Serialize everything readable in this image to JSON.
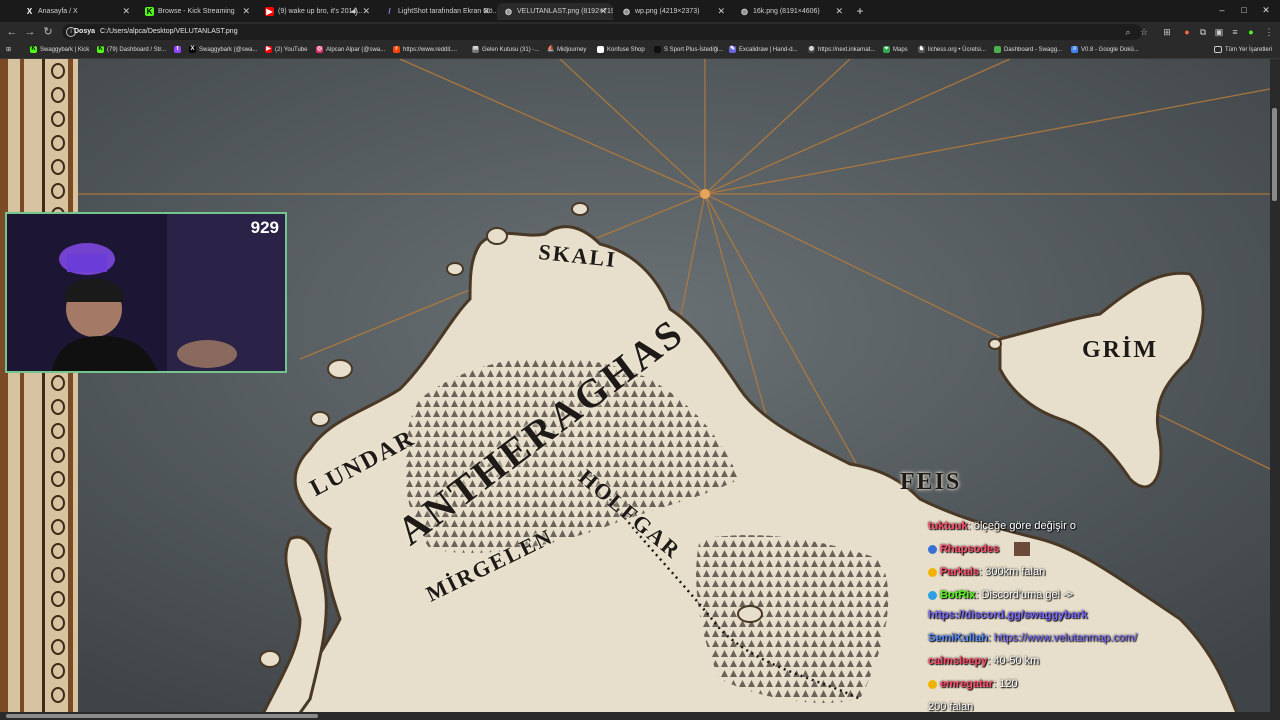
{
  "browser": {
    "tabs": [
      {
        "label": "Anasayfa / X",
        "icon": "x-icon"
      },
      {
        "label": "Browse - Kick Streaming",
        "icon": "kick-icon"
      },
      {
        "label": "(9) wake up bro, it's 2014...",
        "icon": "youtube-icon"
      },
      {
        "label": "LightShot tarafından Ekran Gö...",
        "icon": "lightshot-icon"
      },
      {
        "label": "VELUTANLAST.png (8192×719...",
        "icon": "globe-icon"
      },
      {
        "label": "wp.png (4219×2373)",
        "icon": "globe-icon"
      },
      {
        "label": "16k.png (8191×4606)",
        "icon": "globe-icon"
      }
    ],
    "new_tab": "+",
    "window_controls": {
      "minimize": "–",
      "maximize": "□",
      "close": "✕"
    },
    "address": {
      "scheme": "Dosya",
      "url": "C:/Users/alpca/Desktop/VELUTANLAST.png"
    },
    "bookmarks": [
      {
        "label": "Swaggybark | Kick",
        "color": "#53fc18"
      },
      {
        "label": "(79) Dashboard / Str...",
        "color": "#53fc18"
      },
      {
        "label": "",
        "color": "#9146ff"
      },
      {
        "label": "Swaggybark (@swa...",
        "color": "#000000"
      },
      {
        "label": "(2) YouTube",
        "color": "#ff0000"
      },
      {
        "label": "Alpcan Alpar (@swa...",
        "color": "#e1306c"
      },
      {
        "label": "https://www.reddit....",
        "color": "#ff4500"
      },
      {
        "label": "Gelen Kutusu (31) -...",
        "color": "#777777"
      },
      {
        "label": "Midjourney",
        "color": "#333333"
      },
      {
        "label": "Konfuse Shop",
        "color": "#ffffff"
      },
      {
        "label": "S Sport Plus-İstediği...",
        "color": "#111111"
      },
      {
        "label": "Excalidraw | Hand-d...",
        "color": "#6965db"
      },
      {
        "label": "https://next.inkarnat...",
        "color": "#444444"
      },
      {
        "label": "Maps",
        "color": "#34a853"
      },
      {
        "label": "lichess.org • Ücretsi...",
        "color": "#555555"
      },
      {
        "label": "Dashboard - Swagg...",
        "color": "#4caf50"
      },
      {
        "label": "V0.8 - Google Dokü...",
        "color": "#4285f4"
      }
    ],
    "all_bookmarks": "Tüm Yer İşaretleri"
  },
  "map": {
    "labels": [
      "SKALI",
      "GRİM",
      "LUNDAR",
      "ANTHERAGHAS",
      "FEIS",
      "HOLFGAR",
      "MİRGELEN"
    ]
  },
  "webcam": {
    "viewer_count": "929"
  },
  "chat": [
    {
      "user": "tuktuuk",
      "text": ": ölçeğe göre değişir o",
      "color": "#ff4d6d",
      "badge": ""
    },
    {
      "user": "Rhapsodes",
      "text": "",
      "color": "#ff4d6d",
      "badge": "#3a6fd8",
      "emote": true
    },
    {
      "user": "Parkals",
      "text": ": 300km falan",
      "color": "#ff4d6d",
      "badge": "#f0b400"
    },
    {
      "user": "BotRix",
      "text": ": Discord'uma gel ->",
      "color": "#53fc18",
      "badge": "#2aa0e0"
    },
    {
      "user": "",
      "text": "https://discord.gg/swaggybark",
      "color": "#7b6bff",
      "badge": ""
    },
    {
      "user": "SemiKullah",
      "text": ": https://www.velutanmap.com/",
      "color": "#5a8cff",
      "badge": ""
    },
    {
      "user": "calmsleepy",
      "text": ": 40-50 km",
      "color": "#ff4d6d",
      "badge": ""
    },
    {
      "user": "emregatar",
      "text": ": 120",
      "color": "#ff4d6d",
      "badge": "#f0b400"
    },
    {
      "user": "",
      "text": "200 falan",
      "color": "#ffffff",
      "badge": ""
    }
  ]
}
